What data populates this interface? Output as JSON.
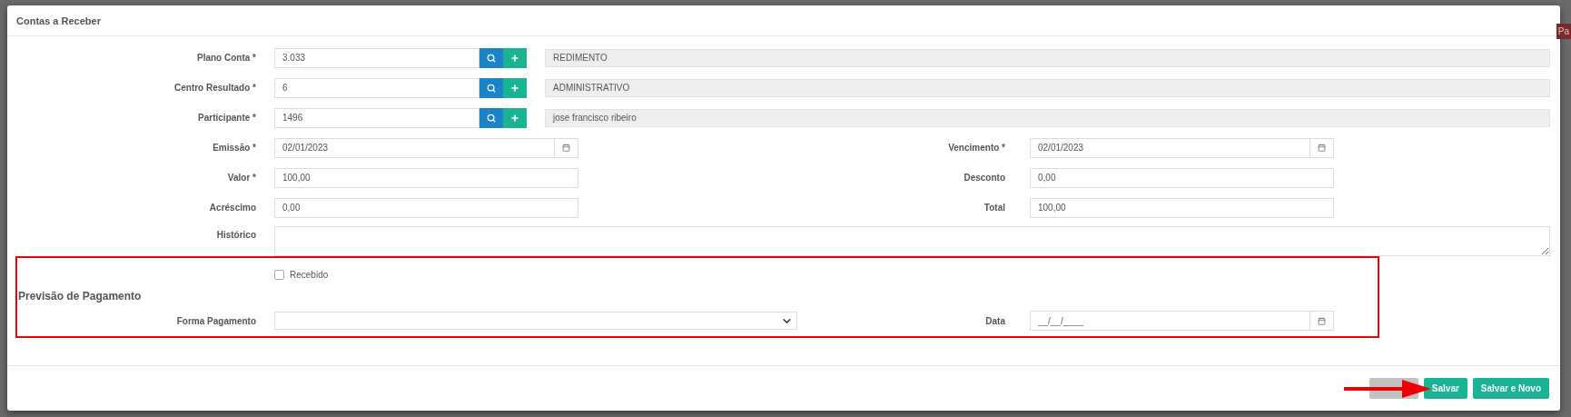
{
  "background": {
    "right_badge": "Pa"
  },
  "window": {
    "title": "Contas a Receber"
  },
  "lookup_rows": [
    {
      "label": "Plano Conta *",
      "code": "3.033",
      "description": "REDIMENTO"
    },
    {
      "label": "Centro Resultado *",
      "code": "6",
      "description": "ADMINISTRATIVO"
    },
    {
      "label": "Participante *",
      "code": "1496",
      "description": "jose francisco ribeiro"
    }
  ],
  "pair_rows": [
    [
      {
        "kind": "date",
        "label": "Emissão *",
        "value": "02/01/2023"
      },
      {
        "kind": "date",
        "label": "Vencimento *",
        "value": "02/01/2023"
      }
    ],
    [
      {
        "kind": "text",
        "label": "Valor *",
        "value": "100,00"
      },
      {
        "kind": "text",
        "label": "Desconto",
        "value": "0,00"
      }
    ],
    [
      {
        "kind": "text",
        "label": "Acréscimo",
        "value": "0,00"
      },
      {
        "kind": "text",
        "label": "Total",
        "value": "100,00"
      }
    ]
  ],
  "historico": {
    "label": "Histórico"
  },
  "recebido": {
    "label": "Recebido",
    "checked": false
  },
  "section_title": "Previsão de Pagamento",
  "payment": {
    "forma_label": "Forma Pagamento",
    "data_label": "Data",
    "data_placeholder": "__/__/____"
  },
  "buttons": [
    {
      "kind": "muted"
    },
    {
      "kind": "primary",
      "label": "Salvar"
    },
    {
      "kind": "primary",
      "label": "Salvar e Novo"
    }
  ],
  "annotations": {
    "highlight": true,
    "arrow": true
  }
}
